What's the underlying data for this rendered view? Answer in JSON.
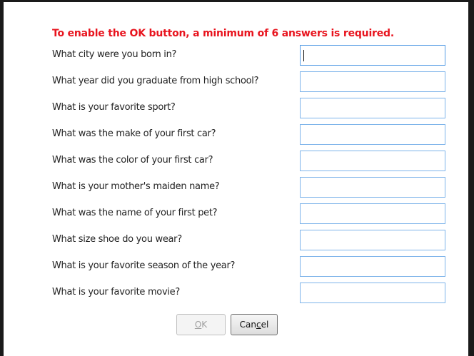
{
  "dialog": {
    "requirement_text": "To enable the OK button, a minimum of 6 answers is required.",
    "questions": [
      {
        "label": "What city were you born in?",
        "value": ""
      },
      {
        "label": "What year did you graduate from high school?",
        "value": ""
      },
      {
        "label": "What is your favorite sport?",
        "value": ""
      },
      {
        "label": "What was the make of your first car?",
        "value": ""
      },
      {
        "label": "What was the color of your first car?",
        "value": ""
      },
      {
        "label": "What is your mother's maiden name?",
        "value": ""
      },
      {
        "label": "What was the name of your first pet?",
        "value": ""
      },
      {
        "label": "What size shoe do you wear?",
        "value": ""
      },
      {
        "label": "What is your favorite season of the year?",
        "value": ""
      },
      {
        "label": "What is your favorite movie?",
        "value": ""
      }
    ],
    "buttons": {
      "ok_label": "OK",
      "ok_enabled": false,
      "cancel_label": "Cancel"
    }
  },
  "colors": {
    "requirement_text": "#e8141e",
    "input_border": "#7eb4ea"
  }
}
